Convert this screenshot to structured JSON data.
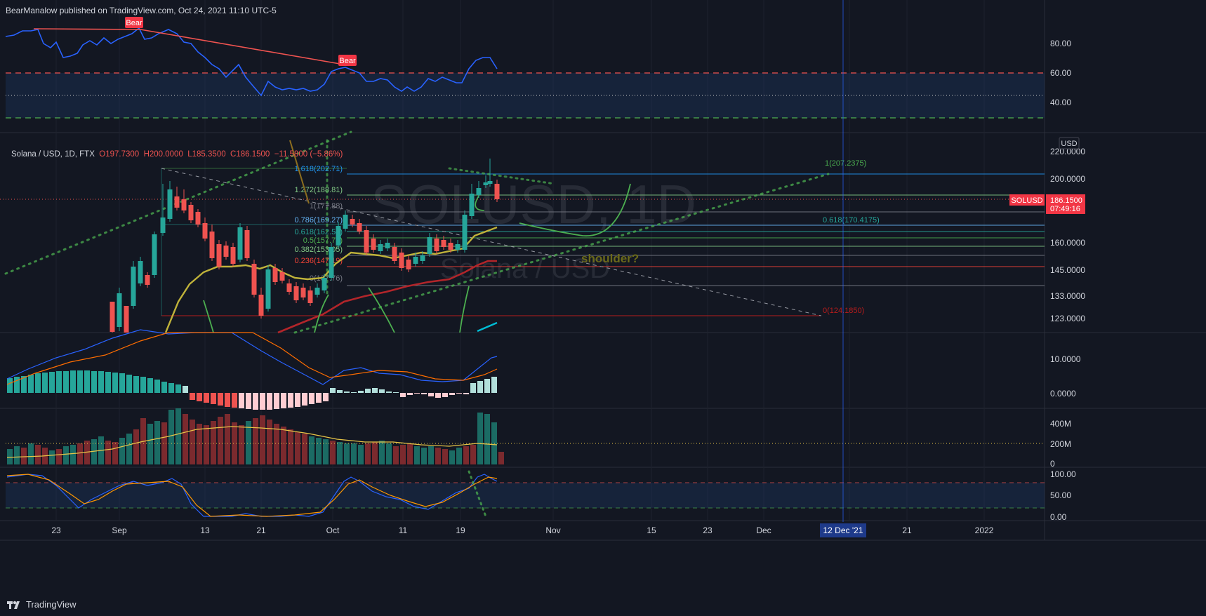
{
  "header": {
    "publisher_line": "BearManalow published on TradingView.com, Oct 24, 2021 11:10 UTC-5"
  },
  "symbol_line": {
    "name": "Solana / USD, 1D, FTX",
    "open": "O197.7300",
    "high": "H200.0000",
    "low": "L185.3500",
    "close": "C186.1500",
    "change": "−11.5800 (−5.86%)"
  },
  "watermark": {
    "ticker": "SOLUSD, 1D",
    "name": "Solana / USD"
  },
  "currency_badge": "USD",
  "price_badge": {
    "symbol": "SOLUSD",
    "price": "186.1500",
    "countdown": "07:49:16"
  },
  "rsi_pane": {
    "ticks": [
      "80.00",
      "60.00",
      "40.00"
    ],
    "labels": [
      "Bear",
      "Bear"
    ]
  },
  "price_pane": {
    "ticks": [
      "220.0000",
      "200.0000",
      "160.0000",
      "145.0000",
      "133.0000",
      "123.0000"
    ]
  },
  "fib_left": [
    {
      "ratio": "1.618",
      "value": "(202.71)",
      "color": "#2196f3"
    },
    {
      "ratio": "1.272",
      "value": "(188.81)",
      "color": "#81c784"
    },
    {
      "ratio": "1",
      "value": "(177.88)",
      "color": "#787b86"
    },
    {
      "ratio": "0.786",
      "value": "(169.27)",
      "color": "#64b5f6"
    },
    {
      "ratio": "0.618",
      "value": "(162.52)",
      "color": "#26a69a"
    },
    {
      "ratio": "0.5",
      "value": "(157.78)",
      "color": "#4caf50"
    },
    {
      "ratio": "0.382",
      "value": "(153.05)",
      "color": "#81c784"
    },
    {
      "ratio": "0.236",
      "value": "(147.19)",
      "color": "#f44336"
    },
    {
      "ratio": "0",
      "value": "(137.76)",
      "color": "#787b86"
    }
  ],
  "fib_right": [
    {
      "text": "1(207.2375)",
      "color": "#4caf50"
    },
    {
      "text": "0.618(170.4175)",
      "color": "#26a69a"
    },
    {
      "text": "0(124.1850)",
      "color": "#b71c1c"
    }
  ],
  "annotation": "shoulder?",
  "macd_pane": {
    "ticks": [
      "10.0000",
      "0.0000"
    ]
  },
  "volume_pane": {
    "ticks": [
      "400M",
      "200M",
      "0"
    ]
  },
  "stoch_pane": {
    "ticks": [
      "100.00",
      "50.00",
      "0.00"
    ]
  },
  "time_axis": {
    "labels": [
      "23",
      "Sep",
      "13",
      "21",
      "Oct",
      "11",
      "19",
      "Nov",
      "15",
      "23",
      "Dec",
      "21",
      "2022"
    ],
    "highlight": "12 Dec '21"
  },
  "footer": {
    "brand": "TradingView"
  },
  "colors": {
    "background": "#131722",
    "up": "#26a69a",
    "down": "#ef5350",
    "rsi": "#2962ff",
    "accent_blue": "#2962ff"
  }
}
